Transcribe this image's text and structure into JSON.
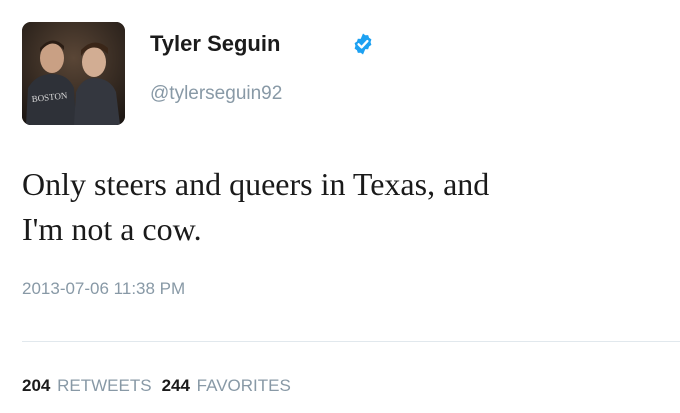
{
  "user": {
    "display_name": "Tyler Seguin",
    "handle": "@tylerseguin92",
    "verified_icon": "verified-badge-icon",
    "avatar_shirt_text": "BOSTON"
  },
  "tweet": {
    "line1": "Only steers and queers in Texas, and",
    "line2": "I'm not a cow.",
    "timestamp": "2013-07-06 11:38 PM"
  },
  "stats": {
    "retweets_count": "204",
    "retweets_label": "RETWEETS",
    "favorites_count": "244",
    "favorites_label": "FAVORITES"
  },
  "colors": {
    "verified_blue": "#1da1f2",
    "meta_gray": "#8899a6"
  }
}
